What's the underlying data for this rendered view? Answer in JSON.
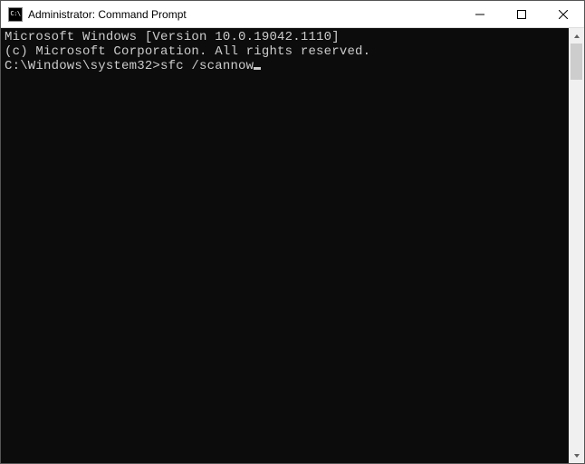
{
  "window": {
    "icon_text": "C:\\",
    "title": "Administrator: Command Prompt"
  },
  "terminal": {
    "line1": "Microsoft Windows [Version 10.0.19042.1110]",
    "line2": "(c) Microsoft Corporation. All rights reserved.",
    "blank": "",
    "prompt": "C:\\Windows\\system32>",
    "command": "sfc /scannow"
  },
  "colors": {
    "terminal_bg": "#0c0c0c",
    "terminal_fg": "#cccccc",
    "titlebar_bg": "#ffffff"
  }
}
